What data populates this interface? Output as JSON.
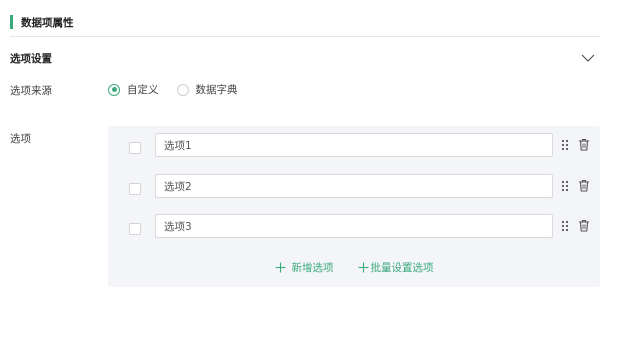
{
  "header": {
    "title": "数据项属性"
  },
  "section": {
    "title": "选项设置"
  },
  "source_row": {
    "label": "选项来源",
    "options": [
      {
        "label": "自定义",
        "checked": true
      },
      {
        "label": "数据字典",
        "checked": false
      }
    ]
  },
  "options_row": {
    "label": "选项",
    "items": [
      {
        "value": "选项1"
      },
      {
        "value": "选项2"
      },
      {
        "value": "选项3"
      }
    ]
  },
  "actions": {
    "add_label": "新增选项",
    "batch_label": "批量设置选项"
  },
  "colors": {
    "accent": "#3aaa7c",
    "panel_bg": "#f4f5f8",
    "border": "#d9d9d9"
  }
}
